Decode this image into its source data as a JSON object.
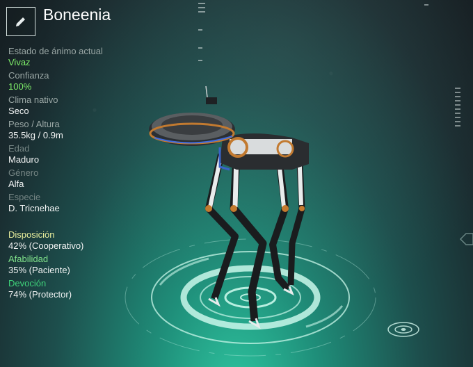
{
  "creature": {
    "name": "Boneenia"
  },
  "stats": [
    {
      "label": "Estado de ánimo actual",
      "value": "Vivaz",
      "highlight": true
    },
    {
      "label": "Confianza",
      "value": "100%",
      "highlight": true
    },
    {
      "label": "Clima nativo",
      "value": "Seco",
      "highlight": false
    },
    {
      "label": "Peso / Altura",
      "value": "35.5kg / 0.9m",
      "highlight": false
    },
    {
      "label": "Edad",
      "value": "Maduro",
      "highlight": false
    },
    {
      "label": "Género",
      "value": "Alfa",
      "highlight": false
    },
    {
      "label": "Especie",
      "value": "D. Tricnehae",
      "highlight": false
    }
  ],
  "traits": [
    {
      "label": "Disposición",
      "value": "42% (Cooperativo)",
      "color": "#e8ee9c"
    },
    {
      "label": "Afabilidad",
      "value": "35% (Paciente)",
      "color": "#7fe08a"
    },
    {
      "label": "Devoción",
      "value": "74% (Protector)",
      "color": "#3fd27a"
    }
  ],
  "icons": {
    "edit": "pencil-icon"
  },
  "colors": {
    "accent_green": "#7ff06a",
    "hologram": "#bff5e6"
  }
}
